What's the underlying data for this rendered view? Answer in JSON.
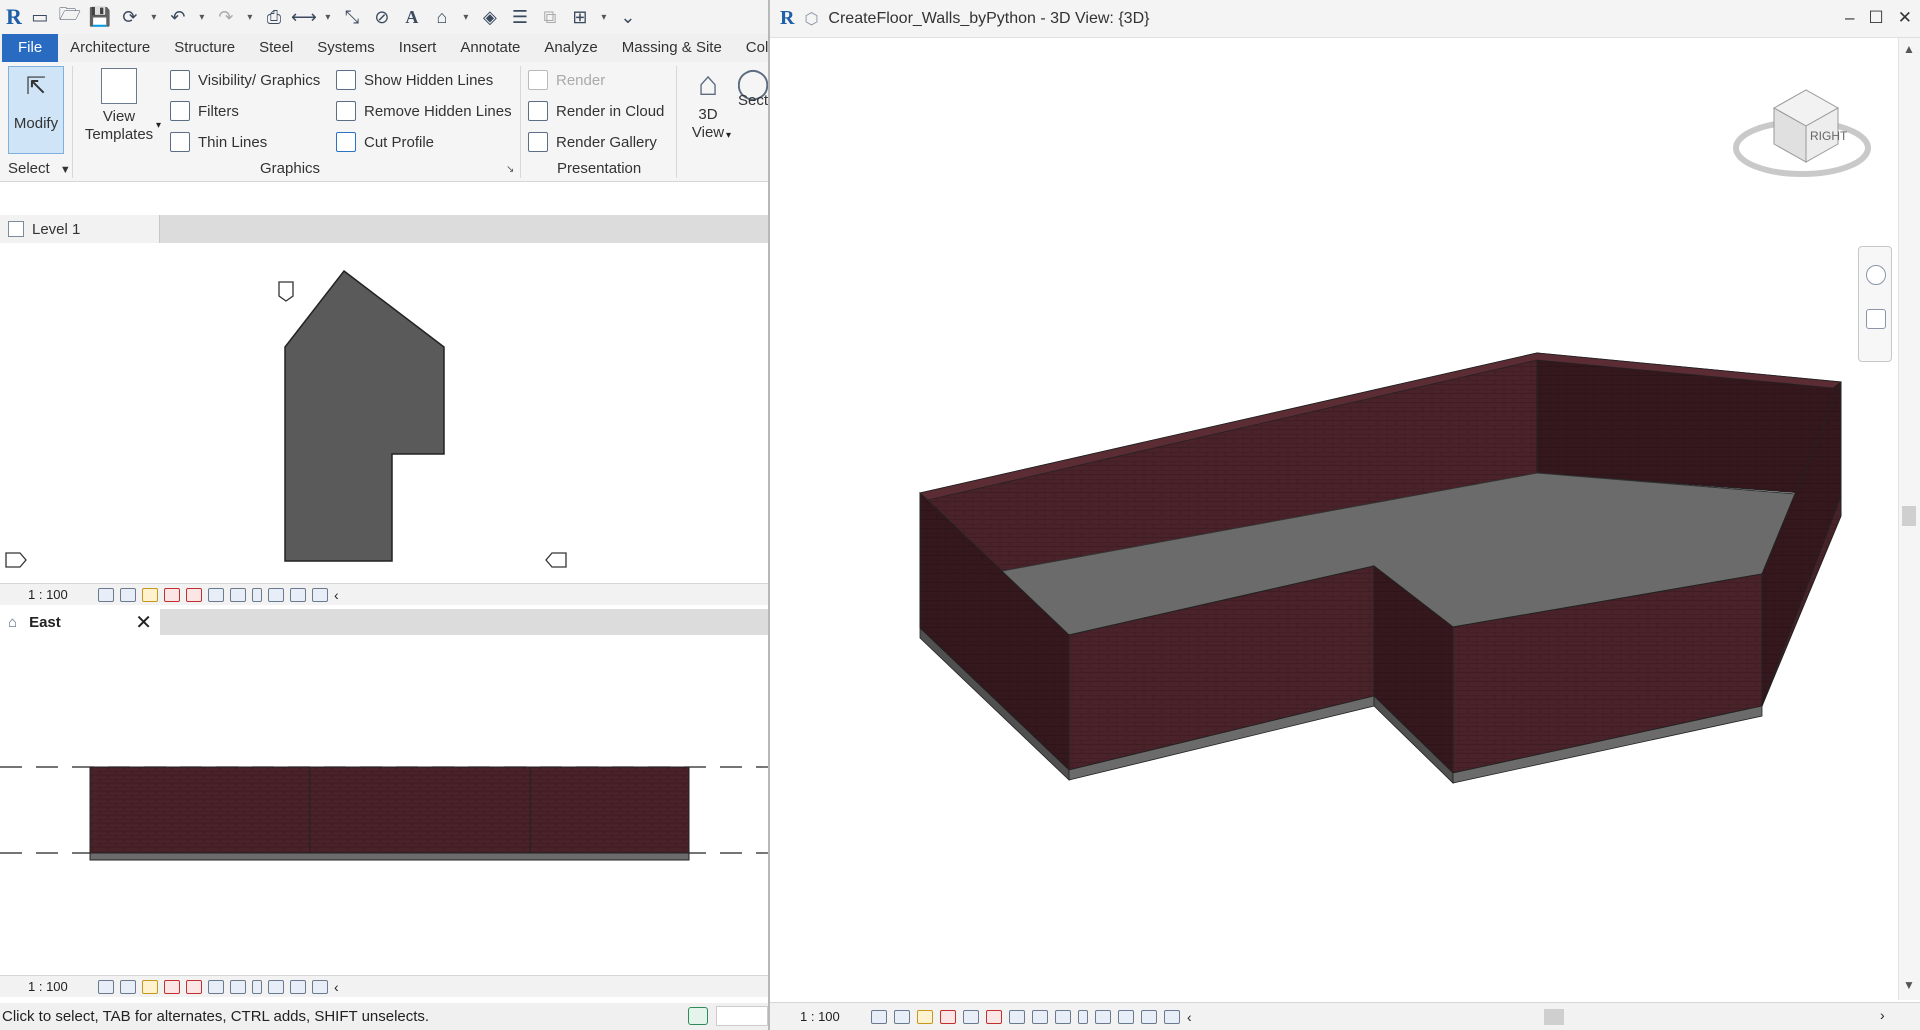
{
  "app": {
    "logo": "R"
  },
  "quick_access": {
    "icons": [
      "open-icon",
      "save-icon",
      "sync-icon",
      "undo-icon",
      "redo-icon",
      "print-icon",
      "measure-icon",
      "dimension-icon",
      "tag-icon",
      "text-icon",
      "3d-view-icon",
      "section-icon",
      "thin-lines-icon",
      "close-hidden-icon",
      "switch-windows-icon",
      "customize-icon"
    ],
    "text_glyph": "A"
  },
  "tabs": [
    "File",
    "Architecture",
    "Structure",
    "Steel",
    "Systems",
    "Insert",
    "Annotate",
    "Analyze",
    "Massing & Site",
    "Coll"
  ],
  "ribbon": {
    "modify_label": "Modify",
    "select_label": "Select",
    "view_templates_label_1": "View",
    "view_templates_label_2": "Templates",
    "graphics": {
      "visibility": "Visibility/  Graphics",
      "filters": "Filters",
      "thin_lines": "Thin  Lines",
      "show_hidden": "Show  Hidden Lines",
      "remove_hidden": "Remove  Hidden Lines",
      "cut_profile": "Cut  Profile",
      "title": "Graphics"
    },
    "presentation": {
      "render": "Render",
      "render_cloud": "Render  in Cloud",
      "render_gallery": "Render  Gallery",
      "title": "Presentation"
    },
    "view3d_label_1": "3D",
    "view3d_label_2": "View",
    "section_label": "Sect"
  },
  "plan_view": {
    "tab_label": "Level 1",
    "scale": "1 : 100"
  },
  "elevation_view": {
    "tab_label": "East",
    "scale": "1 : 100"
  },
  "status": {
    "text": "Click to select, TAB for alternates, CTRL adds, SHIFT unselects."
  },
  "window_3d": {
    "title": "CreateFloor_Walls_byPython - 3D View: {3D}",
    "scale": "1 : 100",
    "viewcube_face": "RIGHT",
    "controls": [
      "–",
      "☐",
      "✕"
    ]
  },
  "colors": {
    "wall": "#4a2229",
    "wall_dark": "#3a1a20",
    "floor": "#6b6b6b",
    "plan_fill": "#5a5a5a",
    "accent": "#2a6bc2"
  }
}
